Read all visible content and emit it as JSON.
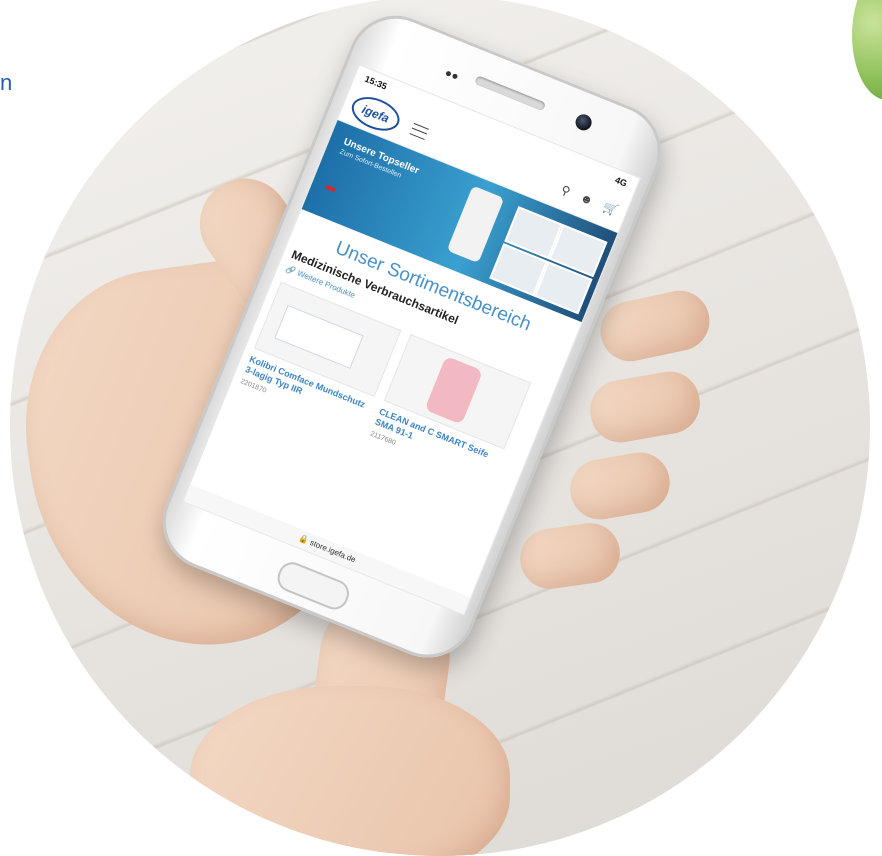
{
  "edge_text": "n",
  "phone": {
    "status_time": "15:35",
    "status_right": "4G",
    "logo_text": "igefa",
    "banner_title": "Unsere Topseller",
    "banner_subtitle": "Zum Sofort-Bestellen",
    "section_title": "Unser Sortimentsbereich",
    "category_title": "Medizinische Verbrauchsartikel",
    "more_link": "Weitere Produkte",
    "products": [
      {
        "name": "Kolibri Comface Mundschutz 3-lagig Typ IIR",
        "sku": "2201870"
      },
      {
        "name": "CLEAN and C SMART Seife SMA 91-1",
        "sku": "2117680"
      }
    ],
    "url": "store.igefa.de"
  },
  "colors": {
    "accent_blue": "#4a90c8",
    "brand_blue": "#1d4f9c",
    "banner_blue": "#1d6fa8"
  }
}
